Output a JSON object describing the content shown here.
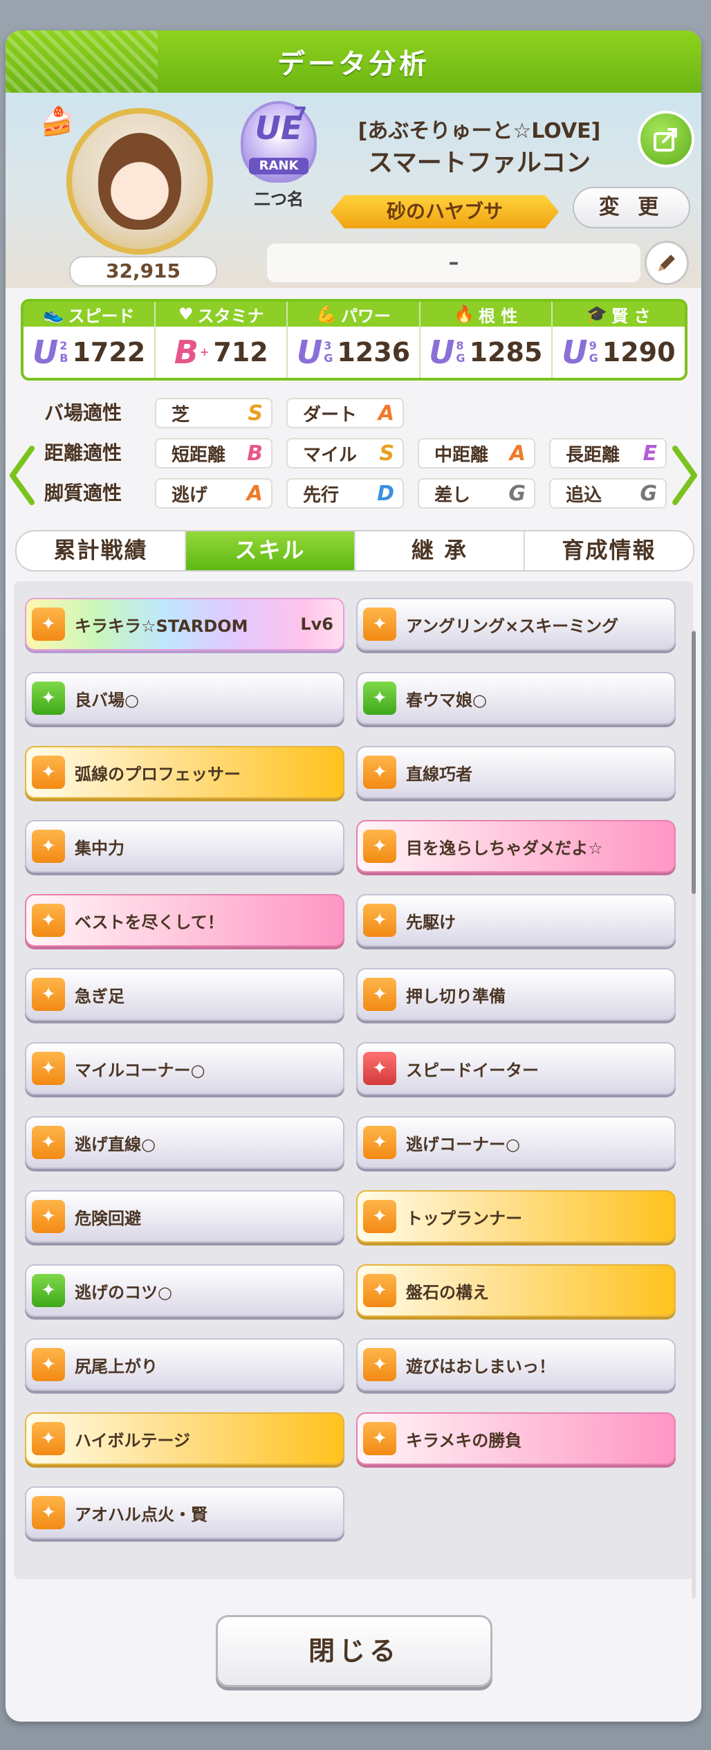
{
  "window": {
    "title": "データ分析"
  },
  "profile": {
    "fans": "32,915",
    "rank_code": "UE",
    "rank_sup": "7",
    "rank_label": "RANK",
    "nitsuna_label": "二つ名",
    "epithet": "[あぶそりゅーと☆LOVE]",
    "name": "スマートファルコン",
    "title_banner": "砂のハヤブサ",
    "change_button": "変 更",
    "comment": "–"
  },
  "stats": [
    {
      "label": "スピード",
      "icon": "shoe-icon",
      "grade": "U",
      "sub1": "2",
      "sub2": "B",
      "value": "1722"
    },
    {
      "label": "スタミナ",
      "icon": "heart-icon",
      "grade": "B",
      "sub1": "+",
      "sub2": "",
      "value": "712"
    },
    {
      "label": "パワー",
      "icon": "muscle-icon",
      "grade": "U",
      "sub1": "3",
      "sub2": "G",
      "value": "1236"
    },
    {
      "label": "根 性",
      "icon": "flame-icon",
      "grade": "U",
      "sub1": "8",
      "sub2": "G",
      "value": "1285"
    },
    {
      "label": "賢 さ",
      "icon": "graduation-cap-icon",
      "grade": "U",
      "sub1": "9",
      "sub2": "G",
      "value": "1290"
    }
  ],
  "aptitude": {
    "rows": [
      {
        "label": "バ場適性",
        "items": [
          {
            "name": "芝",
            "grade": "S"
          },
          {
            "name": "ダート",
            "grade": "A"
          }
        ]
      },
      {
        "label": "距離適性",
        "items": [
          {
            "name": "短距離",
            "grade": "B"
          },
          {
            "name": "マイル",
            "grade": "S"
          },
          {
            "name": "中距離",
            "grade": "A"
          },
          {
            "name": "長距離",
            "grade": "E"
          }
        ]
      },
      {
        "label": "脚質適性",
        "items": [
          {
            "name": "逃げ",
            "grade": "A"
          },
          {
            "name": "先行",
            "grade": "D"
          },
          {
            "name": "差し",
            "grade": "G"
          },
          {
            "name": "追込",
            "grade": "G"
          }
        ]
      }
    ]
  },
  "tabs": [
    "累計戦績",
    "スキル",
    "継 承",
    "育成情報"
  ],
  "active_tab": "スキル",
  "skills": [
    {
      "name": "キラキラ☆STARDOM",
      "level": "Lv6",
      "style": "rainbow",
      "icon": "orange"
    },
    {
      "name": "アングリング×スキーミング",
      "level": "",
      "style": "white",
      "icon": "orange"
    },
    {
      "name": "良バ場○",
      "level": "",
      "style": "white",
      "icon": "green"
    },
    {
      "name": "春ウマ娘○",
      "level": "",
      "style": "white",
      "icon": "green"
    },
    {
      "name": "弧線のプロフェッサー",
      "level": "",
      "style": "gold",
      "icon": "orange"
    },
    {
      "name": "直線巧者",
      "level": "",
      "style": "white",
      "icon": "orange"
    },
    {
      "name": "集中力",
      "level": "",
      "style": "white",
      "icon": "orange"
    },
    {
      "name": "目を逸らしちゃダメだよ☆",
      "level": "",
      "style": "pink",
      "icon": "orange"
    },
    {
      "name": "ベストを尽くして！",
      "level": "",
      "style": "pink",
      "icon": "orange"
    },
    {
      "name": "先駆け",
      "level": "",
      "style": "white",
      "icon": "orange"
    },
    {
      "name": "急ぎ足",
      "level": "",
      "style": "white",
      "icon": "orange"
    },
    {
      "name": "押し切り準備",
      "level": "",
      "style": "white",
      "icon": "orange"
    },
    {
      "name": "マイルコーナー○",
      "level": "",
      "style": "white",
      "icon": "orange"
    },
    {
      "name": "スピードイーター",
      "level": "",
      "style": "white",
      "icon": "red"
    },
    {
      "name": "逃げ直線○",
      "level": "",
      "style": "white",
      "icon": "orange"
    },
    {
      "name": "逃げコーナー○",
      "level": "",
      "style": "white",
      "icon": "orange"
    },
    {
      "name": "危険回避",
      "level": "",
      "style": "white",
      "icon": "orange"
    },
    {
      "name": "トップランナー",
      "level": "",
      "style": "gold",
      "icon": "orange"
    },
    {
      "name": "逃げのコツ○",
      "level": "",
      "style": "white",
      "icon": "green"
    },
    {
      "name": "盤石の構え",
      "level": "",
      "style": "gold",
      "icon": "orange"
    },
    {
      "name": "尻尾上がり",
      "level": "",
      "style": "white",
      "icon": "orange"
    },
    {
      "name": "遊びはおしまいっ！",
      "level": "",
      "style": "white",
      "icon": "orange"
    },
    {
      "name": "ハイボルテージ",
      "level": "",
      "style": "gold",
      "icon": "orange"
    },
    {
      "name": "キラメキの勝負",
      "level": "",
      "style": "pink",
      "icon": "orange"
    },
    {
      "name": "アオハル点火・賢",
      "level": "",
      "style": "white",
      "icon": "orange"
    }
  ],
  "close_button": "閉じる",
  "colors": {
    "accent_green": "#7cc21c",
    "text_brown": "#4b3524",
    "grade_purple": "#8a6fd8"
  }
}
